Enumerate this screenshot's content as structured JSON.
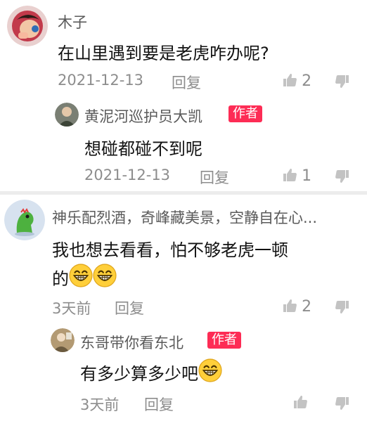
{
  "comments": [
    {
      "user": "木子",
      "text": "在山里遇到要是老虎咋办呢?",
      "date": "2021-12-13",
      "reply_label": "回复",
      "like_count": "2",
      "reply": {
        "user": "黄泥河巡护员大凯",
        "badge": "作者",
        "text": "想碰都碰不到呢",
        "date": "2021-12-13",
        "reply_label": "回复",
        "like_count": "1"
      }
    },
    {
      "user": "神乐配烈酒，奇峰藏美景，空静自在心...",
      "text_line1": "我也想去看看，怕不够老虎一顿",
      "text_line2": "的",
      "date": "3天前",
      "reply_label": "回复",
      "like_count": "2",
      "reply": {
        "user": "东哥带你看东北",
        "badge": "作者",
        "text": "有多少算多少吧",
        "date": "3天前",
        "reply_label": "回复",
        "like_count": ""
      }
    }
  ],
  "icons": {
    "like": "thumbs-up-icon",
    "dislike": "thumbs-down-icon",
    "emoji": "grinning-face-emoji"
  },
  "colors": {
    "badge": "#fd2c55",
    "meta": "#8d8d8d",
    "username": "#5a5a5a",
    "divider": "#ececec"
  }
}
